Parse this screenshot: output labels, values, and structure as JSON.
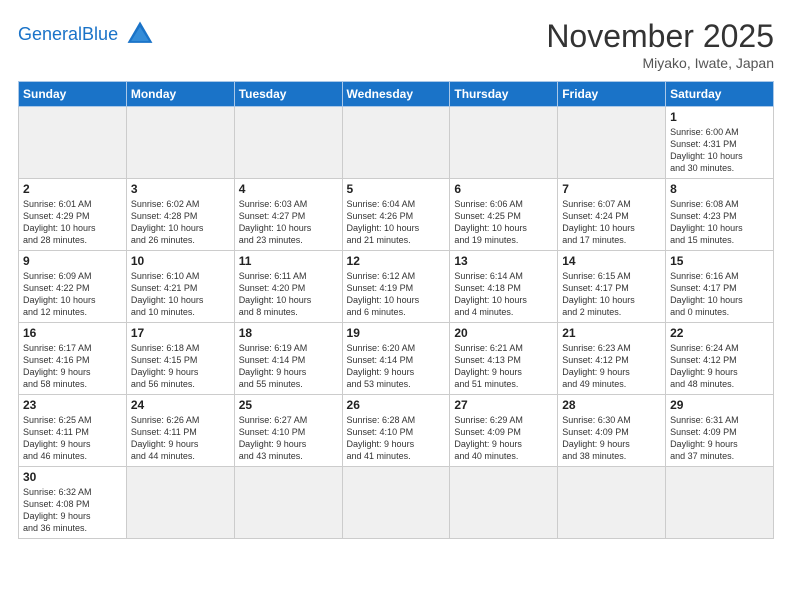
{
  "header": {
    "logo_general": "General",
    "logo_blue": "Blue",
    "month_title": "November 2025",
    "location": "Miyako, Iwate, Japan"
  },
  "weekdays": [
    "Sunday",
    "Monday",
    "Tuesday",
    "Wednesday",
    "Thursday",
    "Friday",
    "Saturday"
  ],
  "weeks": [
    [
      {
        "day": null,
        "empty": true
      },
      {
        "day": null,
        "empty": true
      },
      {
        "day": null,
        "empty": true
      },
      {
        "day": null,
        "empty": true
      },
      {
        "day": null,
        "empty": true
      },
      {
        "day": null,
        "empty": true
      },
      {
        "day": "1",
        "info": "Sunrise: 6:00 AM\nSunset: 4:31 PM\nDaylight: 10 hours\nand 30 minutes."
      }
    ],
    [
      {
        "day": "2",
        "info": "Sunrise: 6:01 AM\nSunset: 4:29 PM\nDaylight: 10 hours\nand 28 minutes."
      },
      {
        "day": "3",
        "info": "Sunrise: 6:02 AM\nSunset: 4:28 PM\nDaylight: 10 hours\nand 26 minutes."
      },
      {
        "day": "4",
        "info": "Sunrise: 6:03 AM\nSunset: 4:27 PM\nDaylight: 10 hours\nand 23 minutes."
      },
      {
        "day": "5",
        "info": "Sunrise: 6:04 AM\nSunset: 4:26 PM\nDaylight: 10 hours\nand 21 minutes."
      },
      {
        "day": "6",
        "info": "Sunrise: 6:06 AM\nSunset: 4:25 PM\nDaylight: 10 hours\nand 19 minutes."
      },
      {
        "day": "7",
        "info": "Sunrise: 6:07 AM\nSunset: 4:24 PM\nDaylight: 10 hours\nand 17 minutes."
      },
      {
        "day": "8",
        "info": "Sunrise: 6:08 AM\nSunset: 4:23 PM\nDaylight: 10 hours\nand 15 minutes."
      }
    ],
    [
      {
        "day": "9",
        "info": "Sunrise: 6:09 AM\nSunset: 4:22 PM\nDaylight: 10 hours\nand 12 minutes."
      },
      {
        "day": "10",
        "info": "Sunrise: 6:10 AM\nSunset: 4:21 PM\nDaylight: 10 hours\nand 10 minutes."
      },
      {
        "day": "11",
        "info": "Sunrise: 6:11 AM\nSunset: 4:20 PM\nDaylight: 10 hours\nand 8 minutes."
      },
      {
        "day": "12",
        "info": "Sunrise: 6:12 AM\nSunset: 4:19 PM\nDaylight: 10 hours\nand 6 minutes."
      },
      {
        "day": "13",
        "info": "Sunrise: 6:14 AM\nSunset: 4:18 PM\nDaylight: 10 hours\nand 4 minutes."
      },
      {
        "day": "14",
        "info": "Sunrise: 6:15 AM\nSunset: 4:17 PM\nDaylight: 10 hours\nand 2 minutes."
      },
      {
        "day": "15",
        "info": "Sunrise: 6:16 AM\nSunset: 4:17 PM\nDaylight: 10 hours\nand 0 minutes."
      }
    ],
    [
      {
        "day": "16",
        "info": "Sunrise: 6:17 AM\nSunset: 4:16 PM\nDaylight: 9 hours\nand 58 minutes."
      },
      {
        "day": "17",
        "info": "Sunrise: 6:18 AM\nSunset: 4:15 PM\nDaylight: 9 hours\nand 56 minutes."
      },
      {
        "day": "18",
        "info": "Sunrise: 6:19 AM\nSunset: 4:14 PM\nDaylight: 9 hours\nand 55 minutes."
      },
      {
        "day": "19",
        "info": "Sunrise: 6:20 AM\nSunset: 4:14 PM\nDaylight: 9 hours\nand 53 minutes."
      },
      {
        "day": "20",
        "info": "Sunrise: 6:21 AM\nSunset: 4:13 PM\nDaylight: 9 hours\nand 51 minutes."
      },
      {
        "day": "21",
        "info": "Sunrise: 6:23 AM\nSunset: 4:12 PM\nDaylight: 9 hours\nand 49 minutes."
      },
      {
        "day": "22",
        "info": "Sunrise: 6:24 AM\nSunset: 4:12 PM\nDaylight: 9 hours\nand 48 minutes."
      }
    ],
    [
      {
        "day": "23",
        "info": "Sunrise: 6:25 AM\nSunset: 4:11 PM\nDaylight: 9 hours\nand 46 minutes."
      },
      {
        "day": "24",
        "info": "Sunrise: 6:26 AM\nSunset: 4:11 PM\nDaylight: 9 hours\nand 44 minutes."
      },
      {
        "day": "25",
        "info": "Sunrise: 6:27 AM\nSunset: 4:10 PM\nDaylight: 9 hours\nand 43 minutes."
      },
      {
        "day": "26",
        "info": "Sunrise: 6:28 AM\nSunset: 4:10 PM\nDaylight: 9 hours\nand 41 minutes."
      },
      {
        "day": "27",
        "info": "Sunrise: 6:29 AM\nSunset: 4:09 PM\nDaylight: 9 hours\nand 40 minutes."
      },
      {
        "day": "28",
        "info": "Sunrise: 6:30 AM\nSunset: 4:09 PM\nDaylight: 9 hours\nand 38 minutes."
      },
      {
        "day": "29",
        "info": "Sunrise: 6:31 AM\nSunset: 4:09 PM\nDaylight: 9 hours\nand 37 minutes."
      }
    ],
    [
      {
        "day": "30",
        "info": "Sunrise: 6:32 AM\nSunset: 4:08 PM\nDaylight: 9 hours\nand 36 minutes."
      },
      {
        "day": null,
        "empty": true
      },
      {
        "day": null,
        "empty": true
      },
      {
        "day": null,
        "empty": true
      },
      {
        "day": null,
        "empty": true
      },
      {
        "day": null,
        "empty": true
      },
      {
        "day": null,
        "empty": true
      }
    ]
  ]
}
